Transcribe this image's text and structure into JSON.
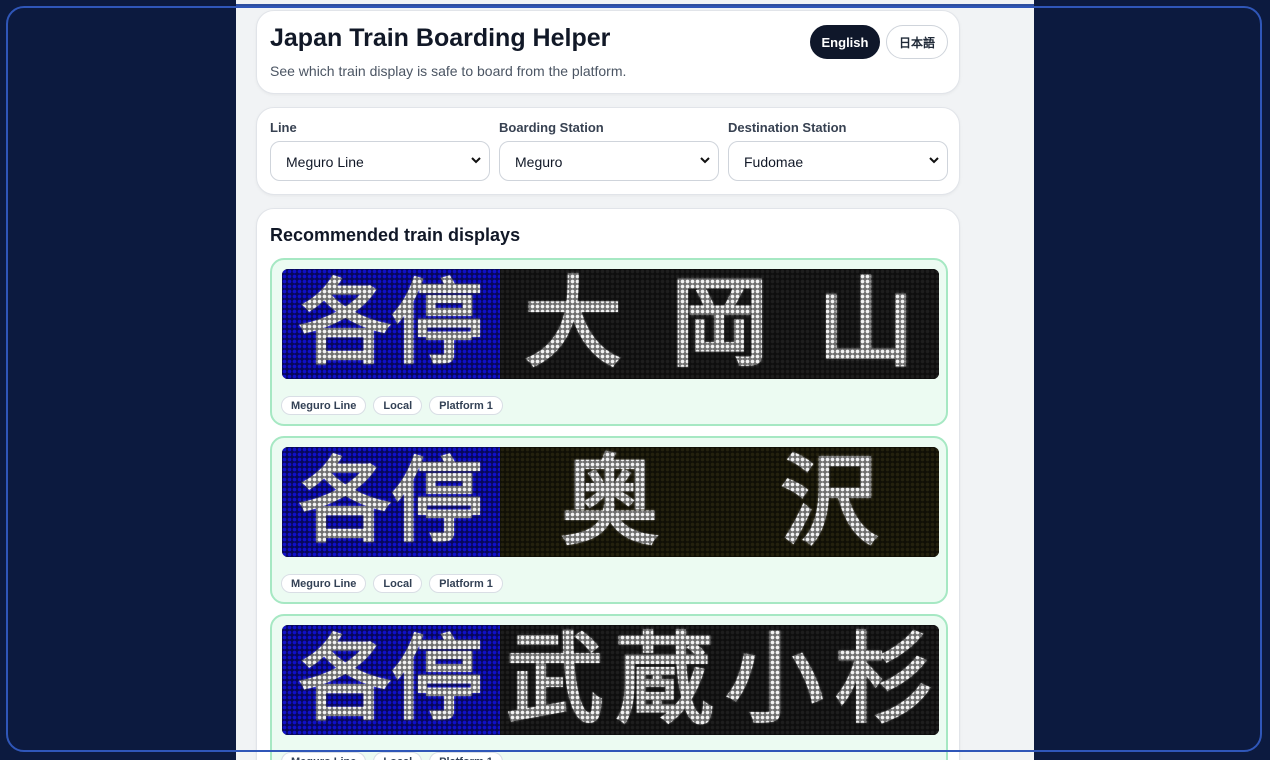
{
  "header": {
    "title": "Japan Train Boarding Helper",
    "subtitle": "See which train display is safe to board from the platform.",
    "lang_en": "English",
    "lang_ja": "日本語"
  },
  "selectors": {
    "line_label": "Line",
    "line_value": "Meguro Line",
    "boarding_label": "Boarding Station",
    "boarding_value": "Meguro",
    "destination_label": "Destination Station",
    "destination_value": "Fudomae"
  },
  "recommendations": {
    "title": "Recommended train displays",
    "trains": [
      {
        "type_chars": [
          "各",
          "停"
        ],
        "dest_chars": [
          "大",
          "岡",
          "山"
        ],
        "line": "Meguro Line",
        "service": "Local",
        "platform": "Platform 1"
      },
      {
        "type_chars": [
          "各",
          "停"
        ],
        "dest_chars": [
          "奥",
          "沢"
        ],
        "line": "Meguro Line",
        "service": "Local",
        "platform": "Platform 1"
      },
      {
        "type_chars": [
          "各",
          "停"
        ],
        "dest_chars": [
          "武",
          "蔵",
          "小",
          "杉"
        ],
        "line": "Meguro Line",
        "service": "Local",
        "platform": "Platform 1"
      }
    ]
  },
  "colors": {
    "type_panel": "#1010c8",
    "dest_panel": "#1e1e1e",
    "card_bg": "#ecfbf2",
    "card_border": "#a6e8c3",
    "primary_button": "#0f172a"
  }
}
